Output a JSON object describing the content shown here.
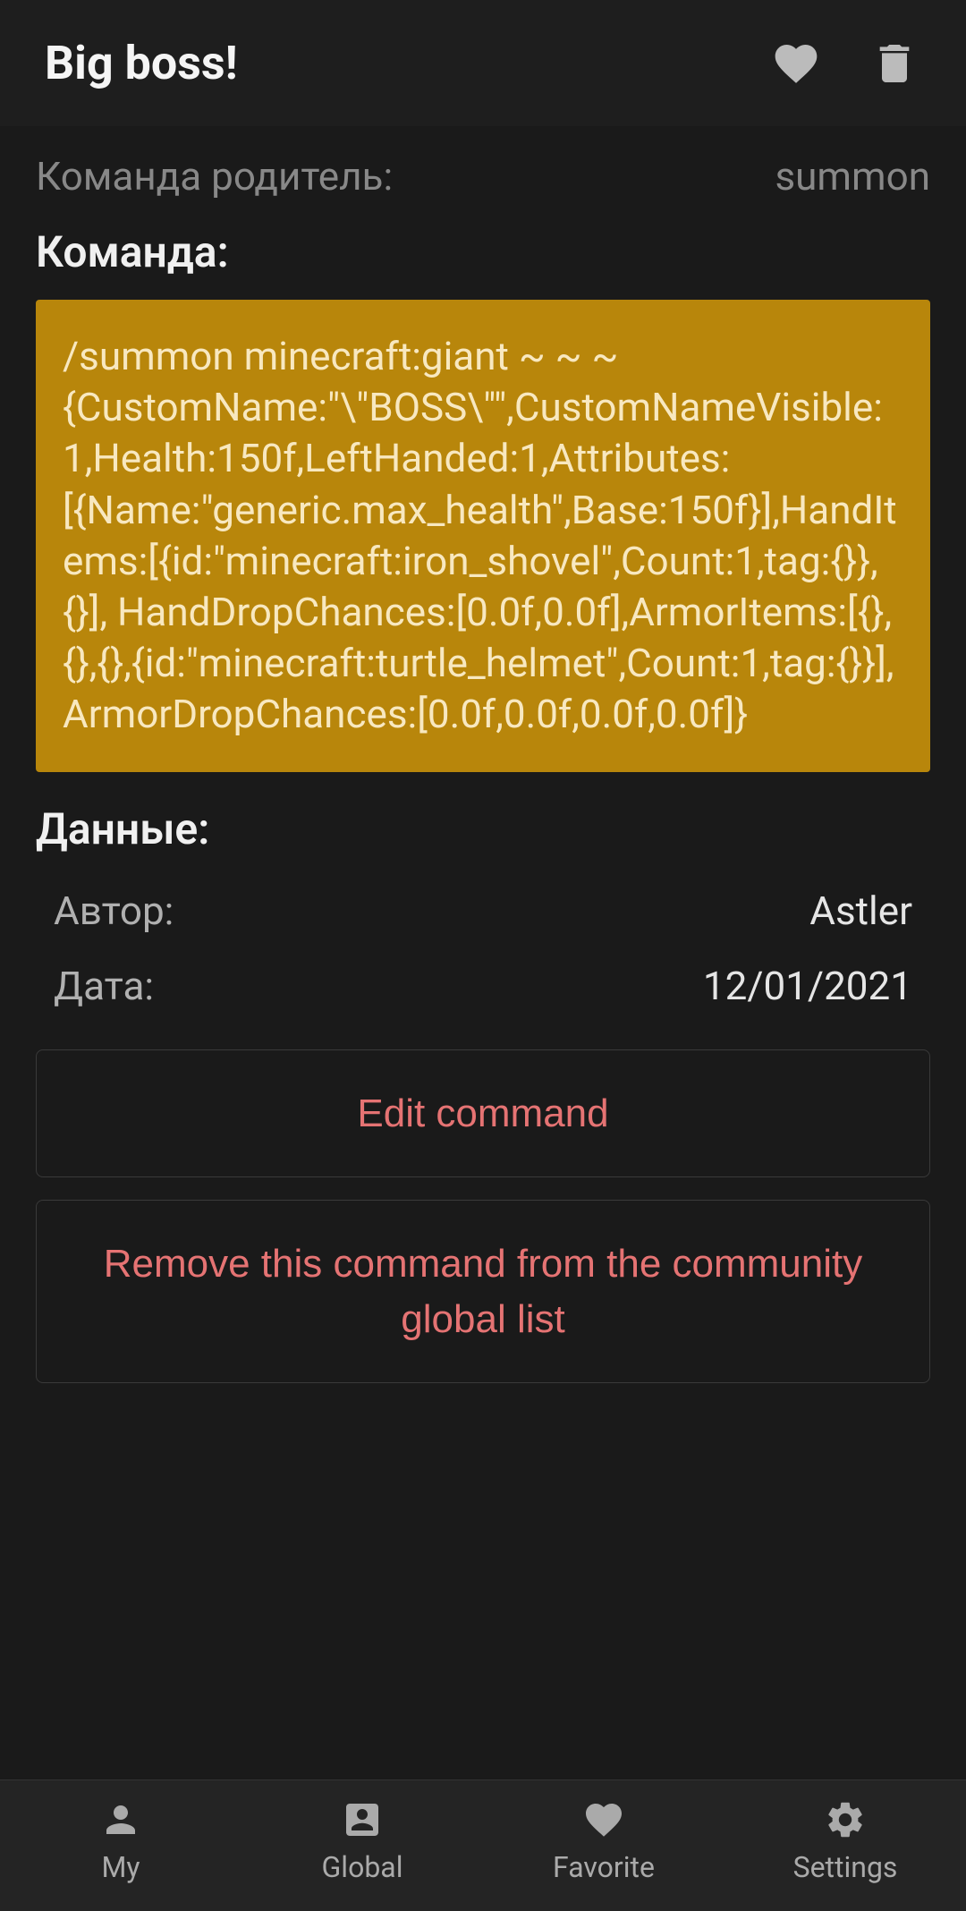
{
  "header": {
    "title": "Big boss!"
  },
  "parent": {
    "label": "Команда родитель:",
    "value": "summon"
  },
  "command": {
    "label": "Команда:",
    "text": "/summon minecraft:giant ~ ~ ~ {CustomName:\"\\\"BOSS\\\"\",CustomNameVisible:1,Health:150f,LeftHanded:1,Attributes:[{Name:\"generic.max_health\",Base:150f}],HandItems:[{id:\"minecraft:iron_shovel\",Count:1,tag:{}},{}], HandDropChances:[0.0f,0.0f],ArmorItems:[{},{},{},{id:\"minecraft:turtle_helmet\",Count:1,tag:{}}], ArmorDropChances:[0.0f,0.0f,0.0f,0.0f]}"
  },
  "data": {
    "label": "Данные:",
    "author_label": "Автор:",
    "author_value": "Astler",
    "date_label": "Дата:",
    "date_value": "12/01/2021"
  },
  "actions": {
    "edit": "Edit command",
    "remove": "Remove this command from the community global list"
  },
  "nav": {
    "my": "My",
    "global": "Global",
    "favorite": "Favorite",
    "settings": "Settings"
  }
}
